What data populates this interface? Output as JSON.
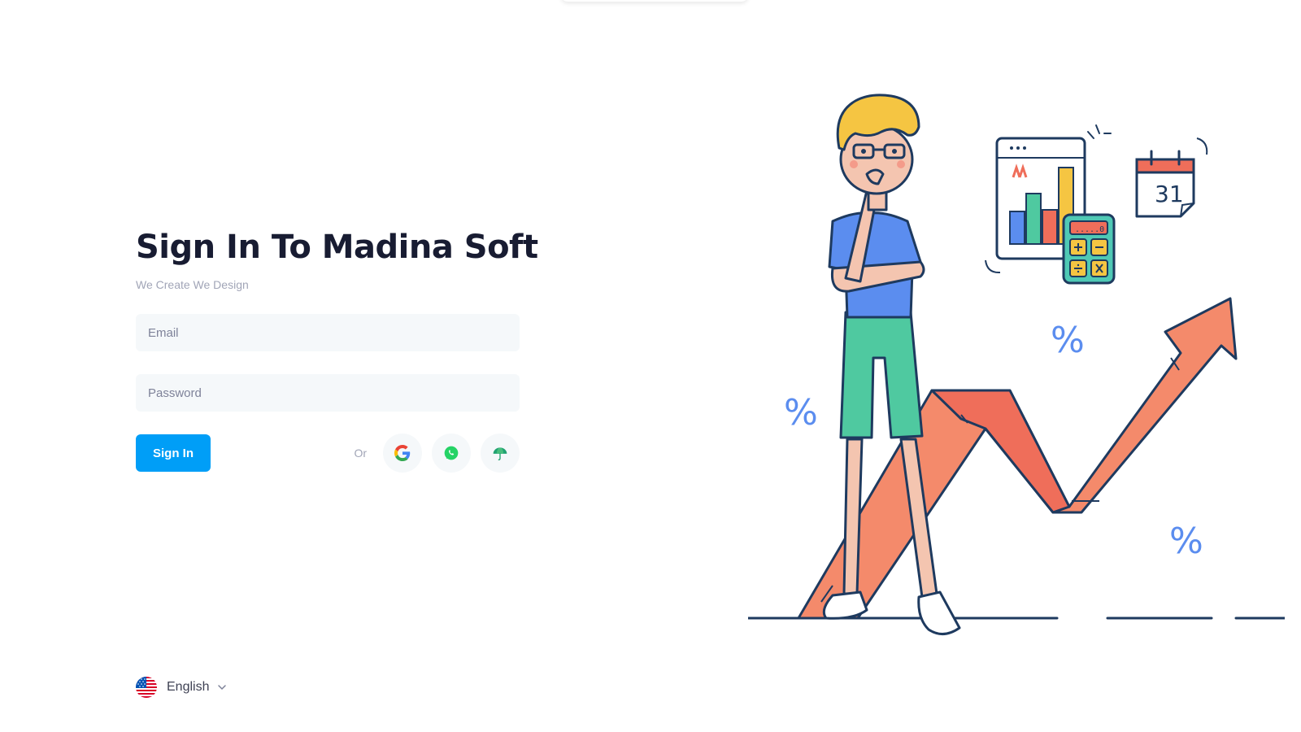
{
  "form": {
    "title": "Sign In To Madina Soft",
    "subtitle": "We Create We Design",
    "email_placeholder": "Email",
    "password_placeholder": "Password",
    "signin_label": "Sign In",
    "or_label": "Or"
  },
  "social": [
    {
      "icon": "google-icon"
    },
    {
      "icon": "whatsapp-icon"
    },
    {
      "icon": "umbrella-icon"
    }
  ],
  "language": {
    "selected": "English",
    "flag": "us-flag-icon"
  },
  "illustration": {
    "calendar_day": "31",
    "percent_symbol": "%",
    "calculator_display": ".....0"
  },
  "colors": {
    "primary": "#009ef7",
    "title": "#181c32",
    "muted": "#a1a5b7",
    "input_bg": "#f5f8fa"
  }
}
